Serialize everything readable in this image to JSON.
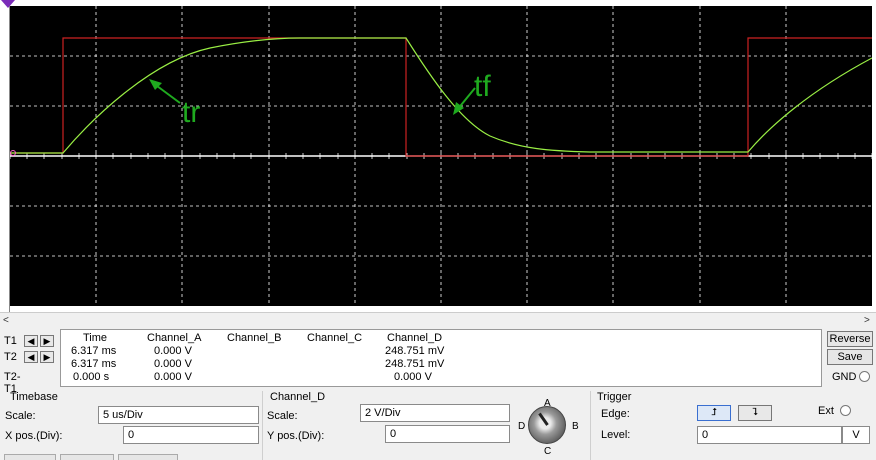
{
  "screen": {
    "annotations": [
      {
        "text": "tr",
        "color": "#1faa1f"
      },
      {
        "text": "tf",
        "color": "#1faa1f"
      }
    ],
    "trace_colors": {
      "input": "#cc2222",
      "output": "#99ee44",
      "grid": "#ffffff",
      "background": "#000000"
    }
  },
  "readout": {
    "headers": [
      "Time",
      "Channel_A",
      "Channel_B",
      "Channel_C",
      "Channel_D"
    ],
    "rows": [
      {
        "label": "T1",
        "time": "6.317 ms",
        "a": "0.000 V",
        "b": "",
        "c": "",
        "d": "248.751 mV"
      },
      {
        "label": "T2",
        "time": "6.317 ms",
        "a": "0.000 V",
        "b": "",
        "c": "",
        "d": "248.751 mV"
      },
      {
        "label": "T2-T1",
        "time": "0.000 s",
        "a": "0.000 V",
        "b": "",
        "c": "",
        "d": "0.000 V"
      }
    ],
    "reverse_label": "Reverse",
    "save_label": "Save",
    "gnd_label": "GND"
  },
  "timebase": {
    "title": "Timebase",
    "scale_label": "Scale:",
    "scale_value": "5 us/Div",
    "xpos_label": "X pos.(Div):",
    "xpos_value": "0"
  },
  "channel": {
    "title": "Channel_D",
    "scale_label": "Scale:",
    "scale_value": "2  V/Div",
    "ypos_label": "Y pos.(Div):",
    "ypos_value": "0",
    "knob_letters": [
      "A",
      "B",
      "C",
      "D"
    ]
  },
  "trigger": {
    "title": "Trigger",
    "edge_label": "Edge:",
    "level_label": "Level:",
    "level_value": "0",
    "level_unit": "V",
    "ext_label": "Ext"
  }
}
